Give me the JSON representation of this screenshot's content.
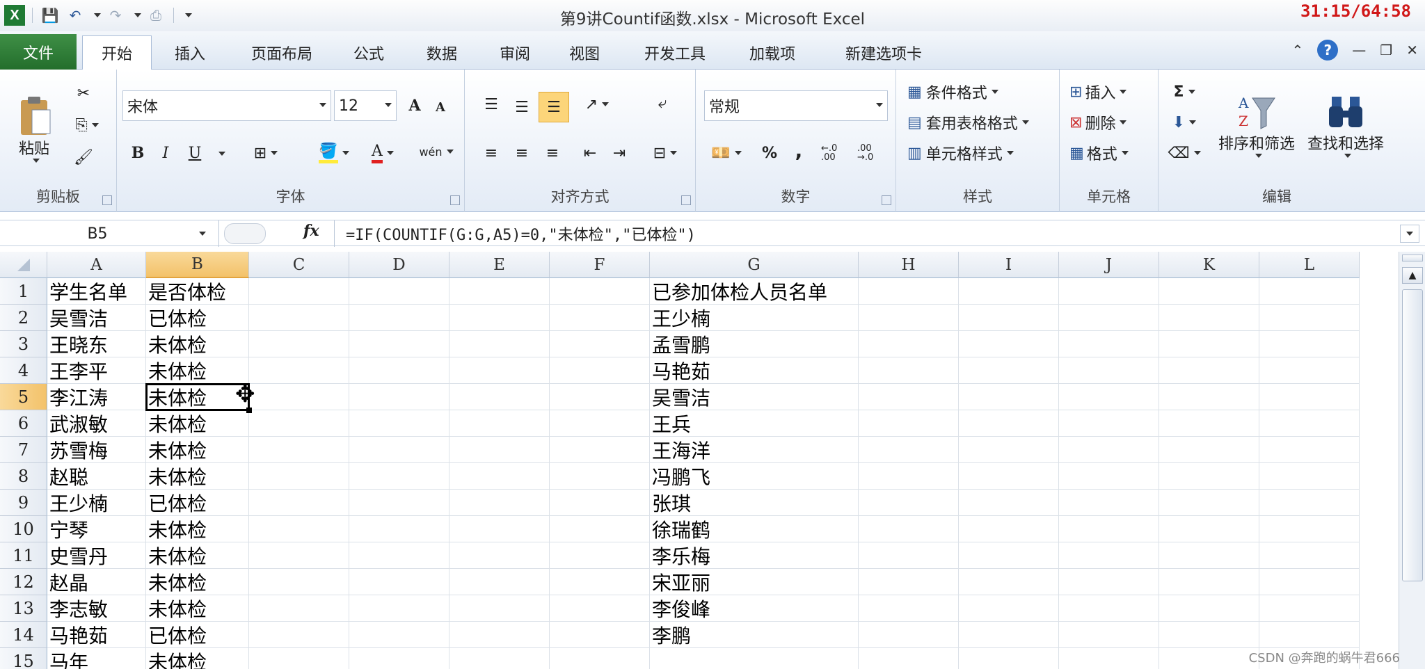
{
  "window": {
    "title": "第9讲Countif函数.xlsx - Microsoft Excel",
    "timer": "31:15/64:58"
  },
  "qat": {
    "excel": "X",
    "save": "💾",
    "undo": "↶",
    "redo": "↷",
    "more": "⎙"
  },
  "tabs": [
    {
      "label": "文件",
      "id": "file"
    },
    {
      "label": "开始",
      "id": "home",
      "active": true
    },
    {
      "label": "插入",
      "id": "insert"
    },
    {
      "label": "页面布局",
      "id": "layout"
    },
    {
      "label": "公式",
      "id": "formulas"
    },
    {
      "label": "数据",
      "id": "data"
    },
    {
      "label": "审阅",
      "id": "review"
    },
    {
      "label": "视图",
      "id": "view"
    },
    {
      "label": "开发工具",
      "id": "developer"
    },
    {
      "label": "加载项",
      "id": "addins"
    },
    {
      "label": "新建选项卡",
      "id": "newtab"
    }
  ],
  "ribbon": {
    "clipboard": {
      "label": "剪贴板",
      "paste": "粘贴"
    },
    "font": {
      "label": "字体",
      "name": "宋体",
      "size": "12",
      "bold": "B",
      "italic": "I",
      "underline": "U",
      "grow": "A",
      "shrink": "A",
      "wen": "wén",
      "fontcolor": "A"
    },
    "alignment": {
      "label": "对齐方式"
    },
    "number": {
      "label": "数字",
      "format": "常规",
      "percent": "%",
      "comma": ",",
      "inc": "←.0 .00",
      "dec": ".00 →.0"
    },
    "styles": {
      "label": "样式",
      "conditional": "条件格式",
      "table": "套用表格格式",
      "cell": "单元格样式"
    },
    "cells": {
      "label": "单元格",
      "insert": "插入",
      "delete": "删除",
      "format": "格式"
    },
    "editing": {
      "label": "编辑",
      "sort": "排序和筛选",
      "find": "查找和选择",
      "sigma": "Σ"
    }
  },
  "formula_bar": {
    "name_box": "B5",
    "fx": "fx",
    "formula": "=IF(COUNTIF(G:G,A5)=0,\"未体检\",\"已体检\")"
  },
  "columns": [
    "A",
    "B",
    "C",
    "D",
    "E",
    "F",
    "G",
    "H",
    "I",
    "J",
    "K",
    "L"
  ],
  "selected_column": "B",
  "selected_row": 5,
  "rows": [
    {
      "n": "1",
      "A": "学生名单",
      "B": "是否体检",
      "G": "已参加体检人员名单"
    },
    {
      "n": "2",
      "A": "吴雪洁",
      "B": "已体检",
      "G": "王少楠"
    },
    {
      "n": "3",
      "A": "王晓东",
      "B": "未体检",
      "G": "孟雪鹏"
    },
    {
      "n": "4",
      "A": "王李平",
      "B": "未体检",
      "G": "马艳茹"
    },
    {
      "n": "5",
      "A": "李江涛",
      "B": "未体检",
      "G": "吴雪洁"
    },
    {
      "n": "6",
      "A": "武淑敏",
      "B": "未体检",
      "G": "王兵"
    },
    {
      "n": "7",
      "A": "苏雪梅",
      "B": "未体检",
      "G": "王海洋"
    },
    {
      "n": "8",
      "A": "赵聪",
      "B": "未体检",
      "G": "冯鹏飞"
    },
    {
      "n": "9",
      "A": "王少楠",
      "B": "已体检",
      "G": "张琪"
    },
    {
      "n": "10",
      "A": "宁琴",
      "B": "未体检",
      "G": "徐瑞鹤"
    },
    {
      "n": "11",
      "A": "史雪丹",
      "B": "未体检",
      "G": "李乐梅"
    },
    {
      "n": "12",
      "A": "赵晶",
      "B": "未体检",
      "G": "宋亚丽"
    },
    {
      "n": "13",
      "A": "李志敏",
      "B": "未体检",
      "G": "李俊峰"
    },
    {
      "n": "14",
      "A": "马艳茹",
      "B": "已体检",
      "G": "李鹏"
    },
    {
      "n": "15",
      "A": "马年",
      "B": "未体检",
      "G": ""
    }
  ],
  "watermark": "CSDN @奔跑的蜗牛君666"
}
